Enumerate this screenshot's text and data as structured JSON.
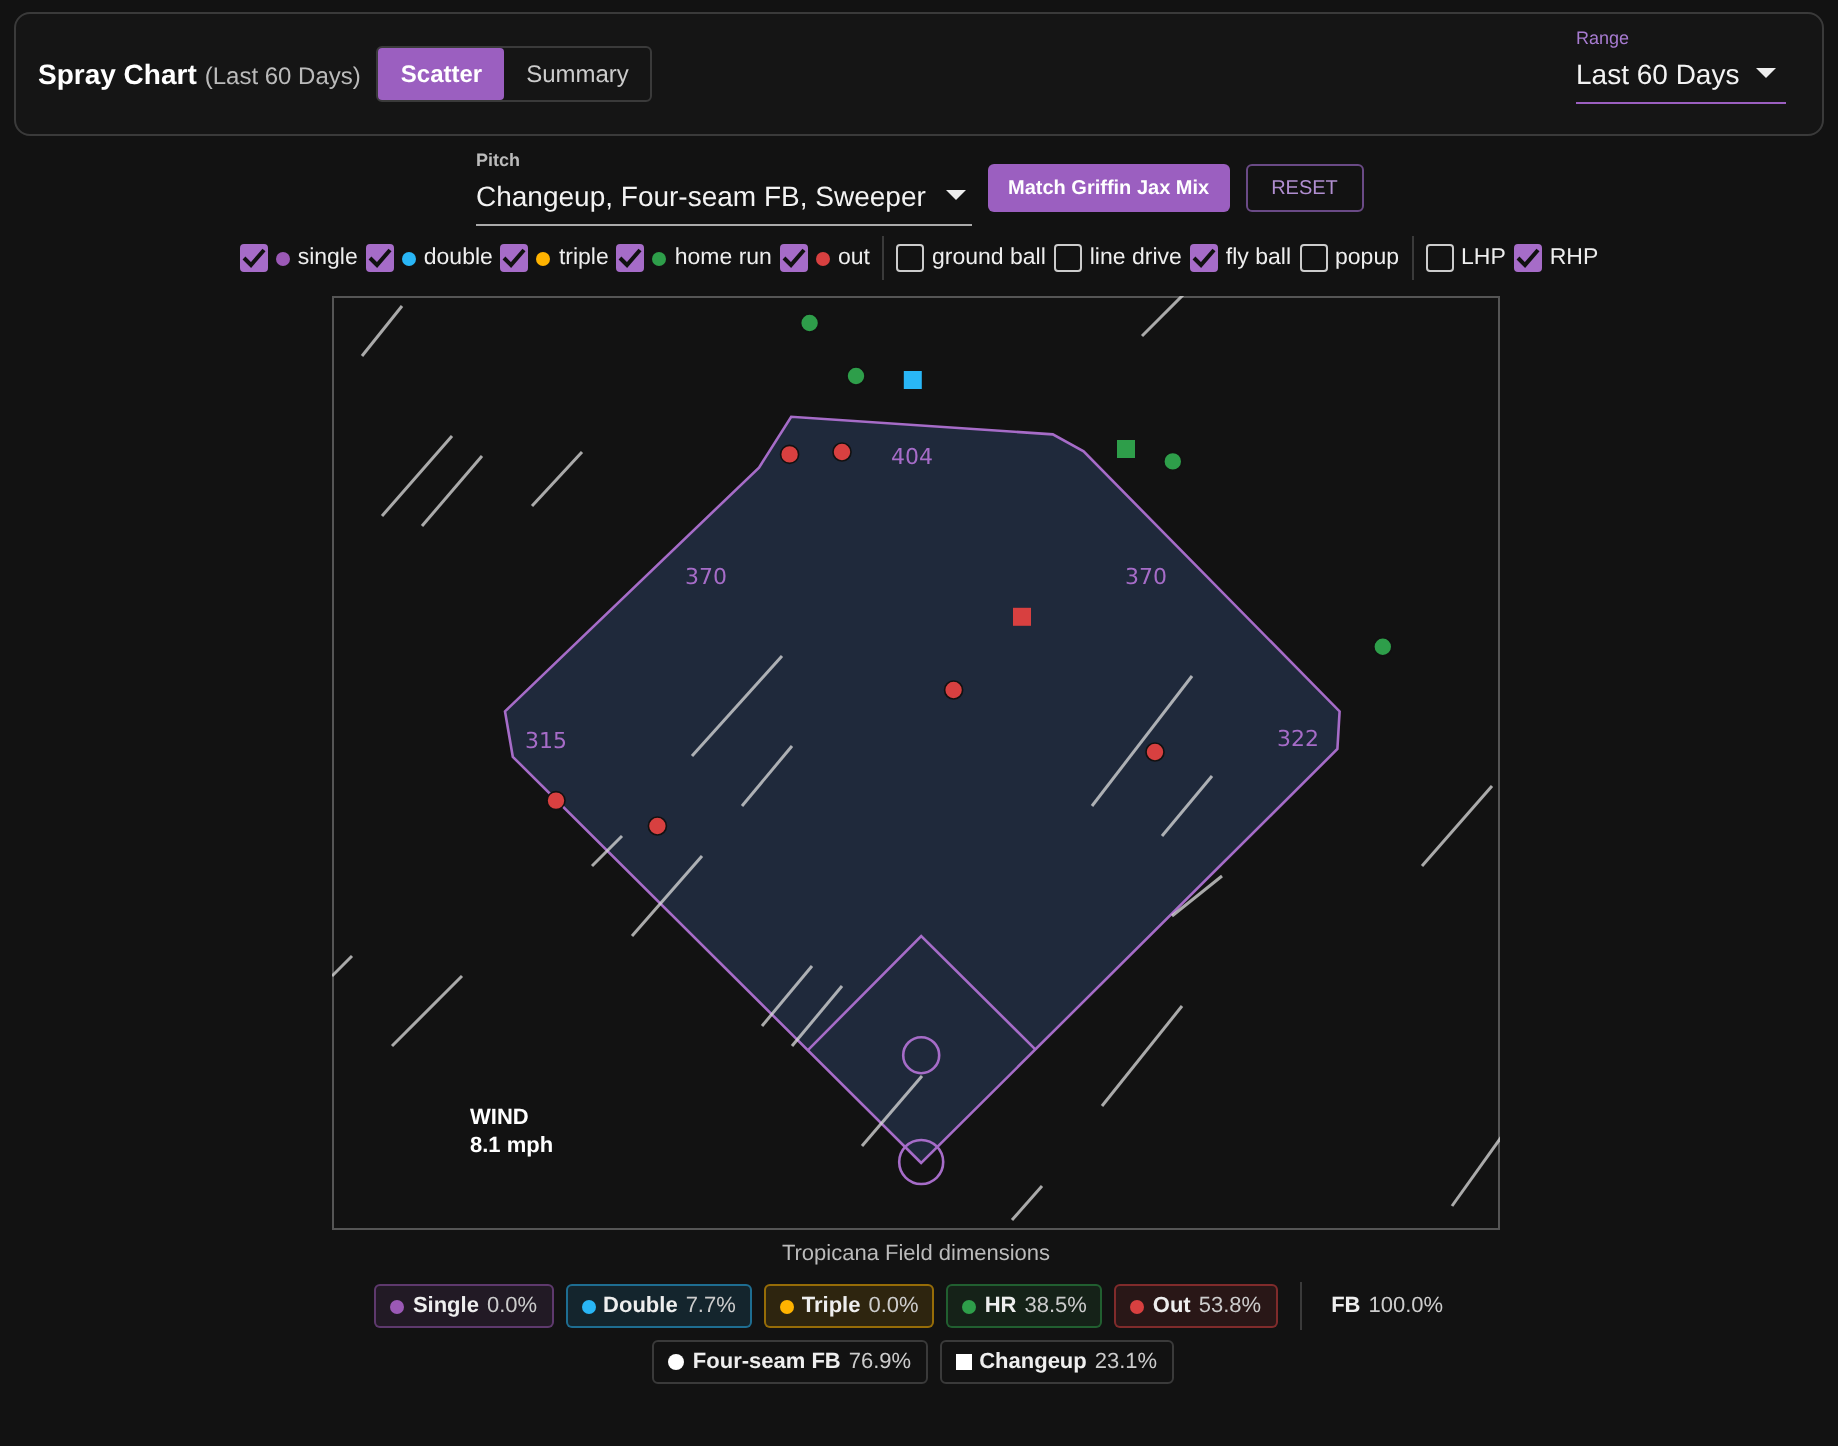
{
  "header": {
    "title": "Spray Chart",
    "subtitle": "(Last 60 Days)",
    "view_tabs": [
      {
        "label": "Scatter",
        "selected": true
      },
      {
        "label": "Summary",
        "selected": false
      }
    ],
    "range": {
      "label": "Range",
      "value": "Last 60 Days"
    }
  },
  "pitch": {
    "label": "Pitch",
    "value": "Changeup, Four-seam FB, Sweeper"
  },
  "buttons": [
    {
      "label": "Match Griffin Jax Mix",
      "kind": "primary"
    },
    {
      "label": "RESET",
      "kind": "outline"
    }
  ],
  "filters": {
    "outcomes": [
      {
        "label": "single",
        "checked": true,
        "color": "#9b59b6"
      },
      {
        "label": "double",
        "checked": true,
        "color": "#29b6f6"
      },
      {
        "label": "triple",
        "checked": true,
        "color": "#ffb300"
      },
      {
        "label": "home run",
        "checked": true,
        "color": "#2e9e4a"
      },
      {
        "label": "out",
        "checked": true,
        "color": "#d84040"
      }
    ],
    "batted_ball": [
      {
        "label": "ground ball",
        "checked": false
      },
      {
        "label": "line drive",
        "checked": false
      },
      {
        "label": "fly ball",
        "checked": true
      },
      {
        "label": "popup",
        "checked": false
      }
    ],
    "handedness": [
      {
        "label": "LHP",
        "checked": false
      },
      {
        "label": "RHP",
        "checked": true
      }
    ]
  },
  "field": {
    "distances": [
      "404",
      "370",
      "370",
      "315",
      "322"
    ],
    "wind_label": "WIND",
    "wind_speed": "8.1 mph",
    "caption": "Tropicana Field dimensions"
  },
  "outcome_summary": [
    {
      "label": "Single",
      "value": "0.0%",
      "color": "#9b59b6"
    },
    {
      "label": "Double",
      "value": "7.7%",
      "color": "#29b6f6"
    },
    {
      "label": "Triple",
      "value": "0.0%",
      "color": "#ffb300"
    },
    {
      "label": "HR",
      "value": "38.5%",
      "color": "#2e9e4a"
    },
    {
      "label": "Out",
      "value": "53.8%",
      "color": "#d84040"
    }
  ],
  "fb_summary": {
    "label": "FB",
    "value": "100.0%"
  },
  "pitch_summary": [
    {
      "label": "Four-seam FB",
      "value": "76.9%",
      "kind": "circle"
    },
    {
      "label": "Changeup",
      "value": "23.1%",
      "kind": "square"
    }
  ]
}
